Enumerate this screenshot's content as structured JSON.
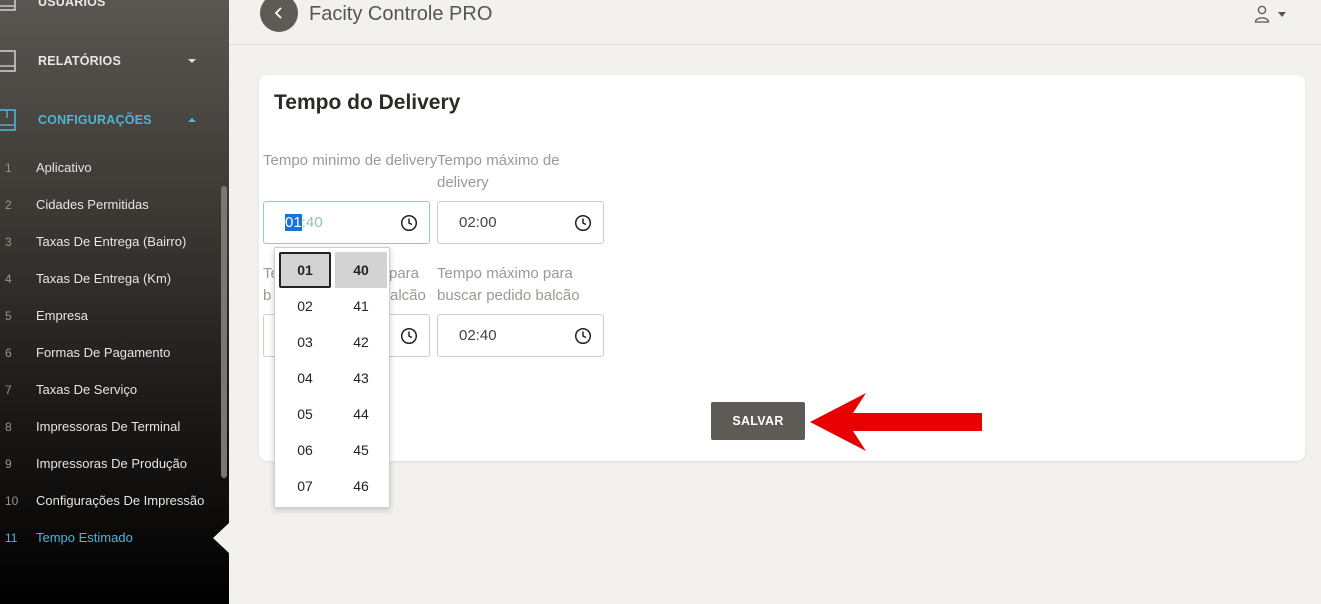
{
  "sidebar": {
    "sections": [
      {
        "label": "USUÁRIOS"
      },
      {
        "label": "RELATÓRIOS"
      },
      {
        "label": "CONFIGURAÇÕES"
      }
    ],
    "items": [
      {
        "num": "1",
        "label": "Aplicativo"
      },
      {
        "num": "2",
        "label": "Cidades Permitidas"
      },
      {
        "num": "3",
        "label": "Taxas De Entrega (Bairro)"
      },
      {
        "num": "4",
        "label": "Taxas De Entrega (Km)"
      },
      {
        "num": "5",
        "label": "Empresa"
      },
      {
        "num": "6",
        "label": "Formas De Pagamento"
      },
      {
        "num": "7",
        "label": "Taxas De Serviço"
      },
      {
        "num": "8",
        "label": "Impressoras De Terminal"
      },
      {
        "num": "9",
        "label": "Impressoras De Produção"
      },
      {
        "num": "10",
        "label": "Configurações De Impressão"
      },
      {
        "num": "11",
        "label": "Tempo Estimado"
      }
    ],
    "active_item": "Tempo Estimado",
    "accent_color": "#4db5d6"
  },
  "header": {
    "title": "Facity Controle PRO",
    "icons": [
      "back-arrow-icon",
      "user-icon",
      "caret-down-icon"
    ]
  },
  "form": {
    "title": "Tempo do Delivery",
    "min_delivery": {
      "label": "Tempo minimo de delivery",
      "hours": "01",
      "minutes": ":40"
    },
    "max_delivery": {
      "label": "Tempo máximo de delivery",
      "value": "02:00"
    },
    "min_balcao": {
      "label_visible_left": "Te",
      "label_visible_right": "para",
      "label2_visible_left": "b",
      "label2_visible_right": "alcão"
    },
    "max_balcao": {
      "label": "Tempo máximo para buscar pedido balcão",
      "value": "02:40"
    },
    "save_label": "SALVAR",
    "save_color": "#5e5a55"
  },
  "time_picker": {
    "hours": [
      "01",
      "02",
      "03",
      "04",
      "05",
      "06",
      "07"
    ],
    "minutes": [
      "40",
      "41",
      "42",
      "43",
      "44",
      "45",
      "46"
    ],
    "selected_hour": "01",
    "selected_minute": "40"
  },
  "annotation": {
    "arrow_color": "#e80000"
  }
}
